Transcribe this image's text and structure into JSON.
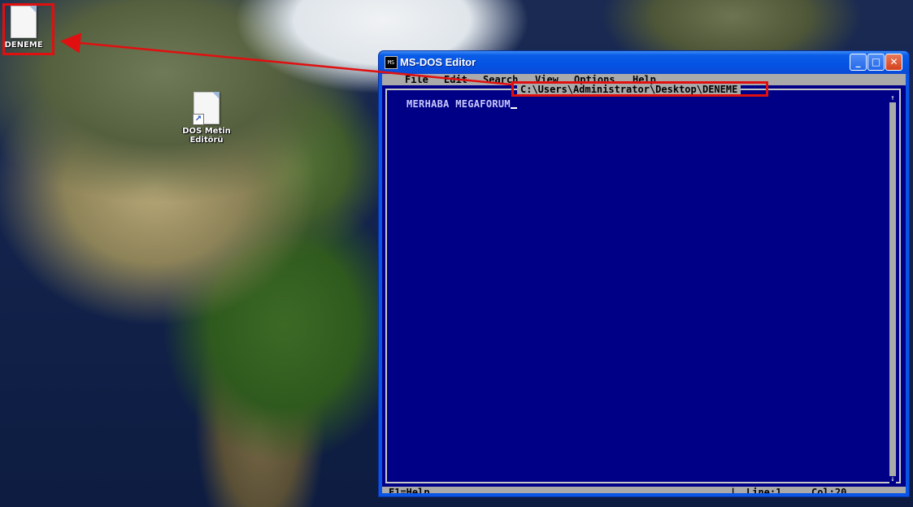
{
  "desktop": {
    "icons": [
      {
        "label": "DENEME"
      },
      {
        "label_line1": "DOS Metin",
        "label_line2": "Editörü"
      }
    ]
  },
  "window": {
    "title": "MS-DOS Editor",
    "icon_text": "MS",
    "controls": {
      "minimize": "_",
      "maximize": "□",
      "close": "✕"
    }
  },
  "menubar": {
    "items": [
      "File",
      "Edit",
      "Search",
      "View",
      "Options",
      "Help"
    ]
  },
  "editor": {
    "file_path": "C:\\Users\\Administrator\\Desktop\\DENEME",
    "content_line1": "MERHABA MEGAFORUM",
    "scroll_up": "↑",
    "scroll_down": "↓"
  },
  "statusbar": {
    "help_hint": "F1=Help",
    "separator": "|",
    "line": "Line:1",
    "col": "Col:20"
  },
  "annotations": {
    "color": "#e01010"
  }
}
